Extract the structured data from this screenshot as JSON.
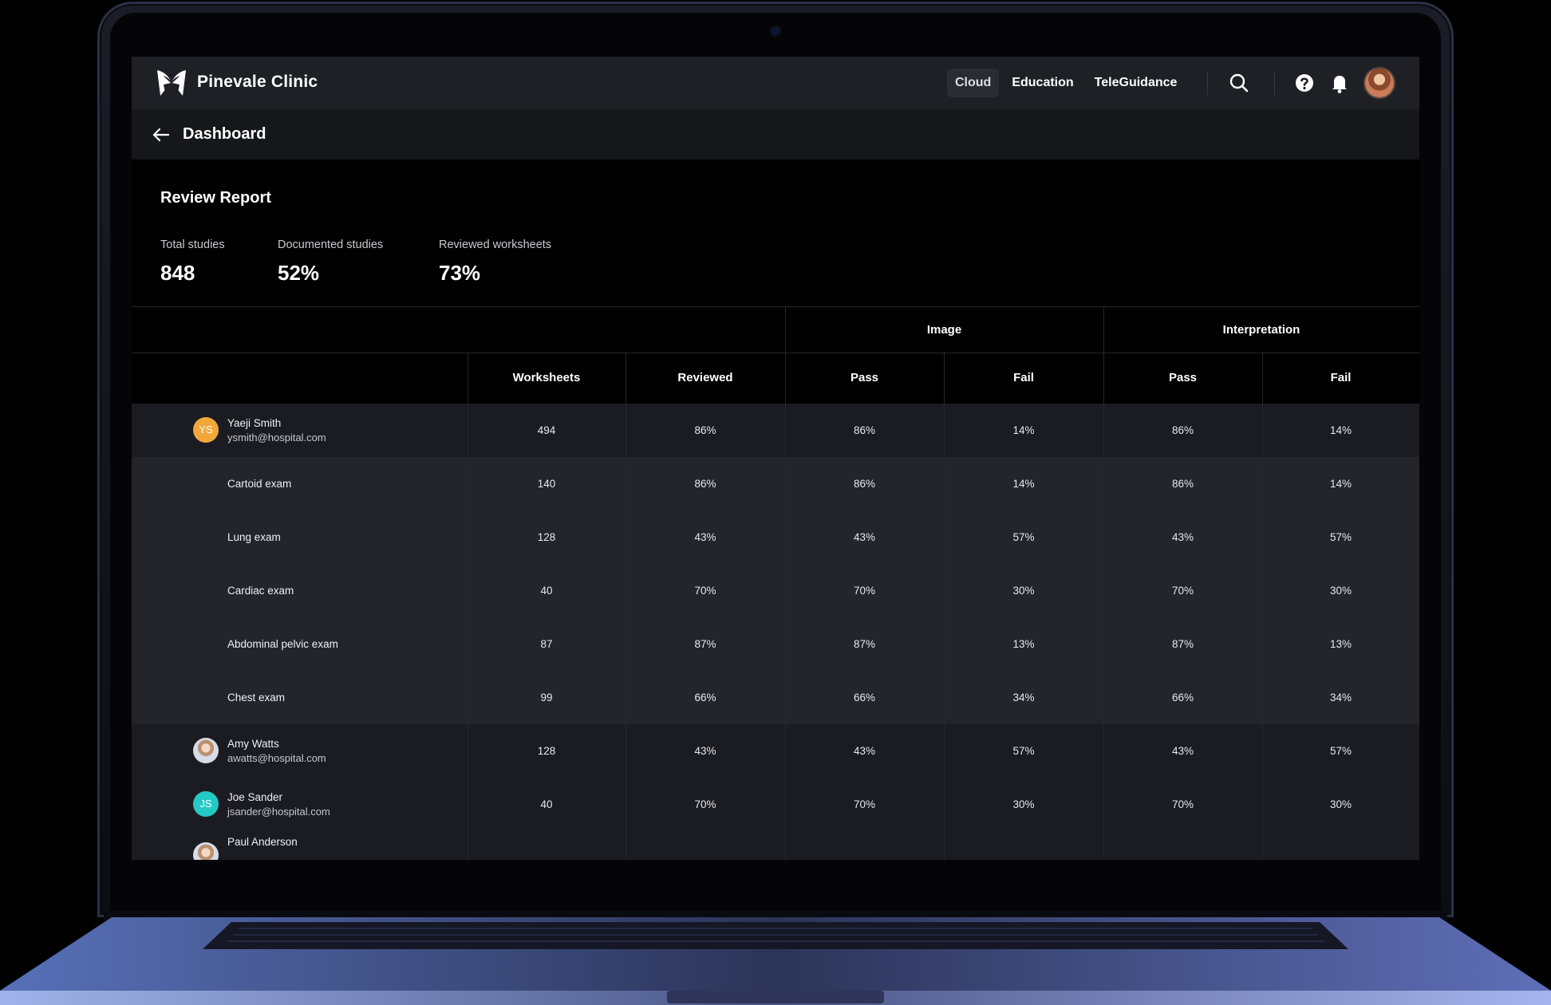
{
  "app": {
    "brand": "Pinevale Clinic",
    "nav": [
      {
        "label": "Cloud",
        "active": true
      },
      {
        "label": "Education",
        "active": false
      },
      {
        "label": "TeleGuidance",
        "active": false
      }
    ],
    "icons": [
      "butterfly-logo-icon",
      "search-icon",
      "help-icon",
      "bell-icon",
      "user-avatar"
    ]
  },
  "subheader": {
    "title": "Dashboard"
  },
  "report": {
    "title": "Review Report",
    "stats": [
      {
        "label": "Total studies",
        "value": "848"
      },
      {
        "label": "Documented studies",
        "value": "52%"
      },
      {
        "label": "Reviewed worksheets",
        "value": "73%"
      }
    ]
  },
  "table": {
    "groups": [
      "Image",
      "Interpretation"
    ],
    "columns": [
      "Worksheets",
      "Reviewed",
      "Pass",
      "Fail",
      "Pass",
      "Fail"
    ],
    "rows": [
      {
        "type": "parent",
        "name": "Yaeji Smith",
        "email": "ysmith@hospital.com",
        "initials": "YS",
        "avatar": "yellow",
        "values": [
          "494",
          "86%",
          "86%",
          "14%",
          "86%",
          "14%"
        ]
      },
      {
        "type": "child",
        "name": "Cartoid exam",
        "values": [
          "140",
          "86%",
          "86%",
          "14%",
          "86%",
          "14%"
        ]
      },
      {
        "type": "child",
        "name": "Lung exam",
        "values": [
          "128",
          "43%",
          "43%",
          "57%",
          "43%",
          "57%"
        ]
      },
      {
        "type": "child",
        "name": "Cardiac exam",
        "values": [
          "40",
          "70%",
          "70%",
          "30%",
          "70%",
          "30%"
        ]
      },
      {
        "type": "child",
        "name": "Abdominal pelvic exam",
        "values": [
          "87",
          "87%",
          "87%",
          "13%",
          "87%",
          "13%"
        ]
      },
      {
        "type": "child",
        "name": "Chest exam",
        "values": [
          "99",
          "66%",
          "66%",
          "34%",
          "66%",
          "34%"
        ]
      },
      {
        "type": "parent",
        "name": "Amy Watts",
        "email": "awatts@hospital.com",
        "initials": "",
        "avatar": "photo",
        "values": [
          "128",
          "43%",
          "43%",
          "57%",
          "43%",
          "57%"
        ]
      },
      {
        "type": "parent",
        "name": "Joe Sander",
        "email": "jsander@hospital.com",
        "initials": "JS",
        "avatar": "teal",
        "values": [
          "40",
          "70%",
          "70%",
          "30%",
          "70%",
          "30%"
        ]
      },
      {
        "type": "parent",
        "name": "Paul Anderson",
        "email": "",
        "initials": "",
        "avatar": "photo",
        "values": [
          "",
          "",
          "",
          "",
          "",
          ""
        ]
      }
    ]
  },
  "colors": {
    "topbar": "#1f2025",
    "subbar": "#16171b",
    "parent_row": "#1b1c21",
    "child_row": "#24252b",
    "avatar_yellow": "#f2a73b",
    "avatar_teal": "#24c9c6"
  }
}
